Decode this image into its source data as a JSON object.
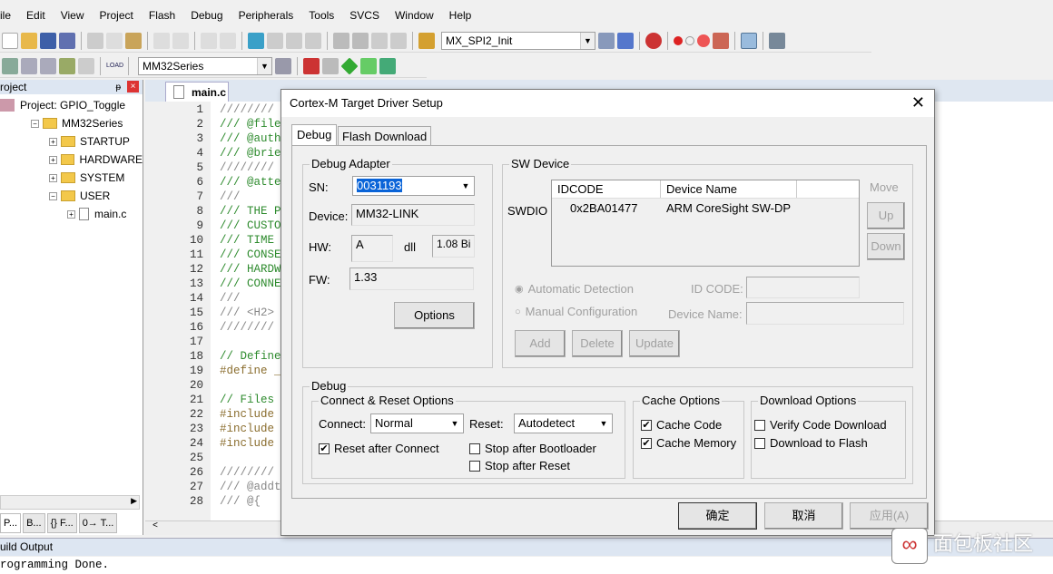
{
  "menu": [
    "ile",
    "Edit",
    "View",
    "Project",
    "Flash",
    "Debug",
    "Peripherals",
    "Tools",
    "SVCS",
    "Window",
    "Help"
  ],
  "toolbar": {
    "function_combo": "MX_SPI2_Init",
    "target_combo": "MM32Series",
    "load_label": "LOAD"
  },
  "project_panel": {
    "title": "roject",
    "tree": [
      {
        "label": "Project: GPIO_Toggle",
        "level": 0
      },
      {
        "label": "MM32Series",
        "level": 1
      },
      {
        "label": "STARTUP",
        "level": 2
      },
      {
        "label": "HARDWARE",
        "level": 2
      },
      {
        "label": "SYSTEM",
        "level": 2
      },
      {
        "label": "USER",
        "level": 2
      },
      {
        "label": "main.c",
        "level": 3
      }
    ],
    "tabs": [
      "P...",
      "B...",
      "{} F...",
      "0→ T..."
    ]
  },
  "editor": {
    "tab": "main.c",
    "lines": [
      [
        "1",
        "////////",
        "gr"
      ],
      [
        "2",
        "/// @file",
        "cm"
      ],
      [
        "3",
        "/// @auth",
        "cm"
      ],
      [
        "4",
        "/// @brie",
        "cm"
      ],
      [
        "5",
        "////////",
        "gr"
      ],
      [
        "6",
        "/// @atte",
        "cm"
      ],
      [
        "7",
        "///",
        "gr"
      ],
      [
        "8",
        "/// THE P",
        "cm"
      ],
      [
        "9",
        "/// CUSTO",
        "cm"
      ],
      [
        "10",
        "/// TIME ",
        "cm"
      ],
      [
        "11",
        "/// CONSE",
        "cm"
      ],
      [
        "12",
        "/// HARDW",
        "cm"
      ],
      [
        "13",
        "/// CONNE",
        "cm"
      ],
      [
        "14",
        "///",
        "gr"
      ],
      [
        "15",
        "/// <H2>",
        "gr"
      ],
      [
        "16",
        "////////",
        "gr"
      ],
      [
        "17",
        "",
        ""
      ],
      [
        "18",
        "// Define",
        "cm"
      ],
      [
        "19",
        "#define _",
        "pp"
      ],
      [
        "20",
        "",
        ""
      ],
      [
        "21",
        "// Files ",
        "cm"
      ],
      [
        "22",
        "#include",
        "pp"
      ],
      [
        "23",
        "#include",
        "pp"
      ],
      [
        "24",
        "#include",
        "pp"
      ],
      [
        "25",
        "",
        ""
      ],
      [
        "26",
        "////////",
        "gr"
      ],
      [
        "27",
        "/// @addt",
        "gr"
      ],
      [
        "28",
        "/// @{",
        "gr"
      ]
    ]
  },
  "build_output": {
    "title": "uild Output",
    "text": "rogramming Done."
  },
  "dialog": {
    "title": "Cortex-M Target Driver Setup",
    "tabs": [
      "Debug",
      "Flash Download"
    ],
    "adapter": {
      "title": "Debug Adapter",
      "sn_label": "SN:",
      "sn": "0031193",
      "device_label": "Device:",
      "device": "MM32-LINK",
      "hw_label": "HW:",
      "hw": "A",
      "dll_label": "dll",
      "dll": "1.08  Bi",
      "fw_label": "FW:",
      "fw": "1.33",
      "options": "Options"
    },
    "sw": {
      "title": "SW Device",
      "swdio": "SWDIO",
      "col_idcode": "IDCODE",
      "col_name": "Device Name",
      "idcode": "0x2BA01477",
      "name": "ARM CoreSight SW-DP",
      "move": "Move",
      "up": "Up",
      "down": "Down",
      "auto": "Automatic Detection",
      "manual": "Manual Configuration",
      "idcode_label": "ID CODE:",
      "devname_label": "Device Name:",
      "add": "Add",
      "delete": "Delete",
      "update": "Update"
    },
    "debug": {
      "title": "Debug",
      "connect_reset": "Connect & Reset Options",
      "connect_label": "Connect:",
      "connect": "Normal",
      "reset_label": "Reset:",
      "reset": "Autodetect",
      "reset_after_connect": "Reset after Connect",
      "stop_bootloader": "Stop after Bootloader",
      "stop_reset": "Stop after Reset",
      "cache_title": "Cache Options",
      "cache_code": "Cache Code",
      "cache_memory": "Cache Memory",
      "download_title": "Download Options",
      "verify": "Verify Code Download",
      "download_flash": "Download to Flash"
    },
    "checks": {
      "reset_after_connect": true,
      "stop_bootloader": false,
      "stop_reset": false,
      "cache_code": true,
      "cache_memory": true,
      "verify": false,
      "download_flash": false
    },
    "ok": "确定",
    "cancel": "取消",
    "apply": "应用(A)"
  },
  "watermark": {
    "text": "面包板社区"
  }
}
